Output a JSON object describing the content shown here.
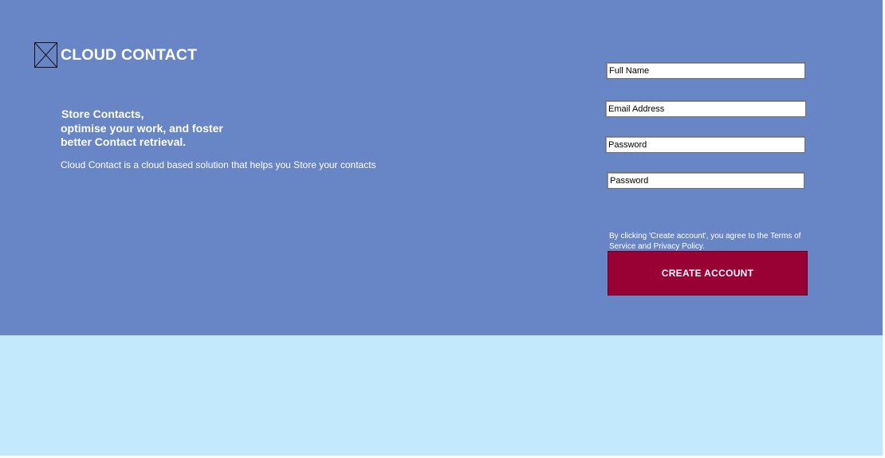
{
  "brand": {
    "title": "CLOUD CONTACT",
    "logo_icon": "broken-image-icon"
  },
  "hero": {
    "tagline_lines": [
      "Store Contacts,",
      "optimise your work, and foster",
      "better Contact retrieval."
    ],
    "description": "Cloud Contact is a cloud based solution that helps you Store your contacts"
  },
  "form": {
    "full_name": {
      "placeholder": "Full Name",
      "value": ""
    },
    "email": {
      "placeholder": "Email Address",
      "value": ""
    },
    "password": {
      "placeholder": "Password",
      "value": ""
    },
    "password_confirm": {
      "placeholder": "Password",
      "value": ""
    },
    "terms_text": "By clicking 'Create account', you agree to the Terms of Service and Privacy Policy.",
    "submit_label": "CREATE ACCOUNT"
  },
  "colors": {
    "hero_bg": "#6886c5",
    "footer_bg": "#c2eafc",
    "button_bg": "#990033",
    "text_light": "#ffffff"
  }
}
